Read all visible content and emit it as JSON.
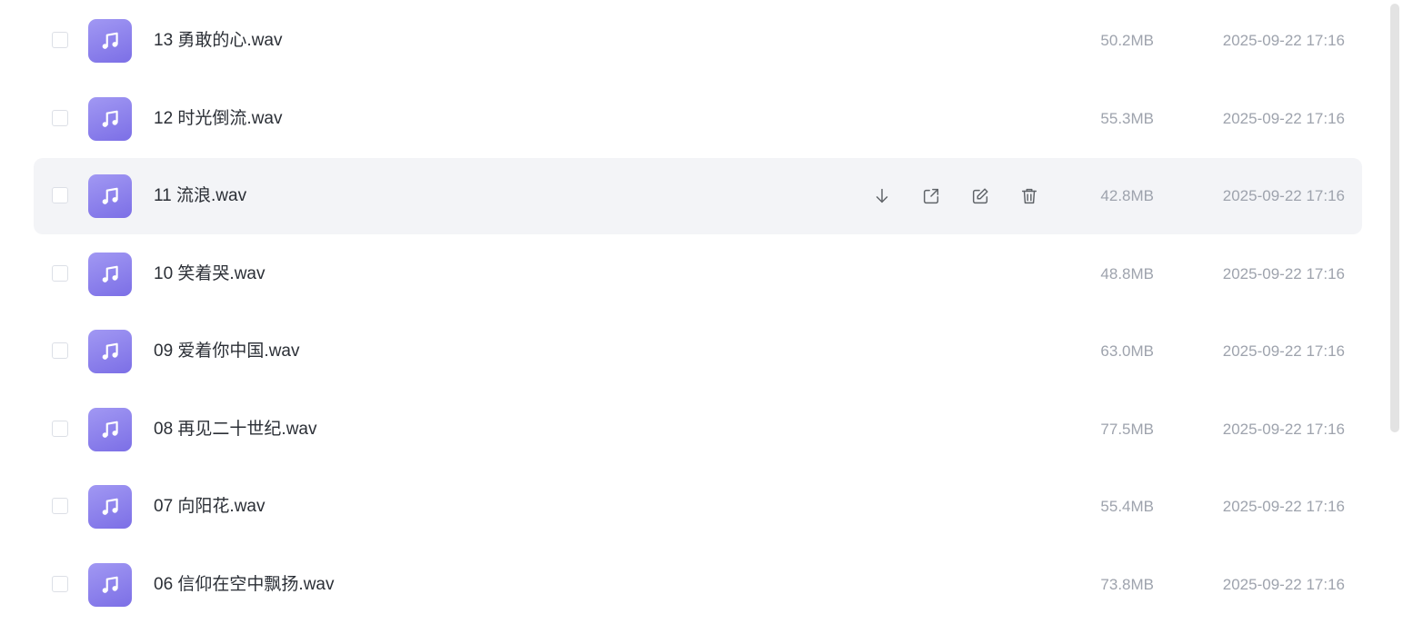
{
  "file_icon": "music-note-icon",
  "colors": {
    "icon_gradient_start": "#a198f3",
    "icon_gradient_end": "#7c6fe6",
    "row_hover": "#f3f4f7",
    "name_text": "#2b2f36",
    "meta_text": "#9ea3ad"
  },
  "row_actions": [
    {
      "name": "download",
      "icon": "download-icon"
    },
    {
      "name": "share",
      "icon": "share-icon"
    },
    {
      "name": "rename",
      "icon": "edit-icon"
    },
    {
      "name": "delete",
      "icon": "trash-icon"
    }
  ],
  "files": [
    {
      "name": "13 勇敢的心.wav",
      "size": "50.2MB",
      "date": "2025-09-22 17:16"
    },
    {
      "name": "12 时光倒流.wav",
      "size": "55.3MB",
      "date": "2025-09-22 17:16"
    },
    {
      "name": "11 流浪.wav",
      "size": "42.8MB",
      "date": "2025-09-22 17:16",
      "hovered": true
    },
    {
      "name": "10 笑着哭.wav",
      "size": "48.8MB",
      "date": "2025-09-22 17:16"
    },
    {
      "name": "09 爱着你中国.wav",
      "size": "63.0MB",
      "date": "2025-09-22 17:16"
    },
    {
      "name": "08 再见二十世纪.wav",
      "size": "77.5MB",
      "date": "2025-09-22 17:16"
    },
    {
      "name": "07 向阳花.wav",
      "size": "55.4MB",
      "date": "2025-09-22 17:16"
    },
    {
      "name": "06 信仰在空中飘扬.wav",
      "size": "73.8MB",
      "date": "2025-09-22 17:16"
    }
  ]
}
